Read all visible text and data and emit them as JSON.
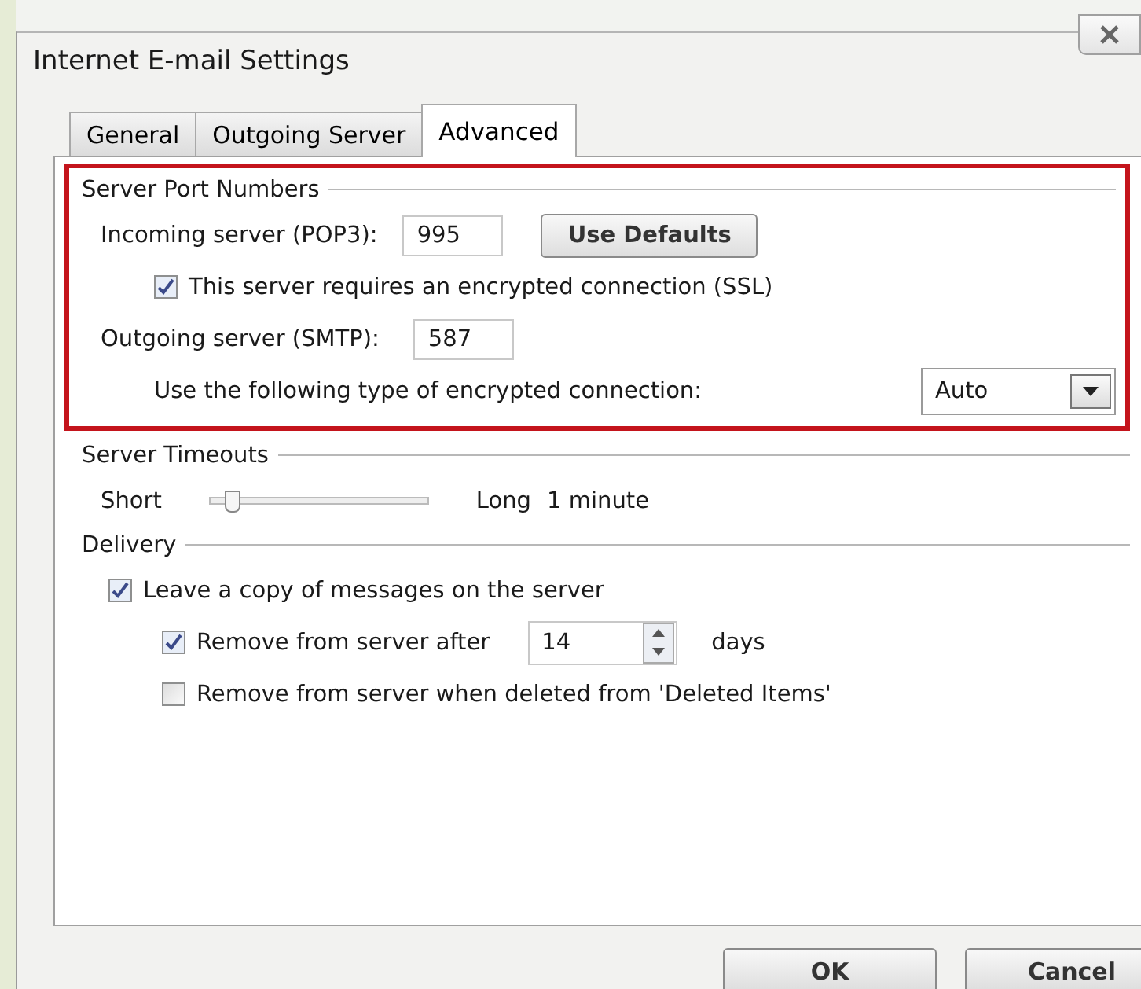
{
  "window": {
    "title": "Internet E-mail Settings"
  },
  "tabs": [
    {
      "label": "General",
      "selected": false
    },
    {
      "label": "Outgoing Server",
      "selected": false
    },
    {
      "label": "Advanced",
      "selected": true
    }
  ],
  "server_port_numbers": {
    "title": "Server Port Numbers",
    "highlighted": true,
    "incoming_label": "Incoming server (POP3):",
    "incoming_value": "995",
    "use_defaults": "Use Defaults",
    "ssl": {
      "label": "This server requires an encrypted connection (SSL)",
      "checked": true
    },
    "outgoing_label": "Outgoing server (SMTP):",
    "outgoing_value": "587",
    "encryption_label": "Use the following type of encrypted connection:",
    "encryption_value": "Auto"
  },
  "server_timeouts": {
    "title": "Server Timeouts",
    "min_label": "Short",
    "max_label": "Long",
    "level": 0.1,
    "reading": "1 minute"
  },
  "delivery": {
    "title": "Delivery",
    "leave_copy": {
      "label": "Leave a copy of messages on the server",
      "checked": true
    },
    "remove_after": {
      "label": "Remove from server after",
      "checked": true,
      "value": "14",
      "unit": "days"
    },
    "remove_deleted": {
      "label": "Remove from server when deleted from 'Deleted Items'",
      "checked": false
    }
  },
  "buttons": [
    "OK",
    "Cancel"
  ]
}
